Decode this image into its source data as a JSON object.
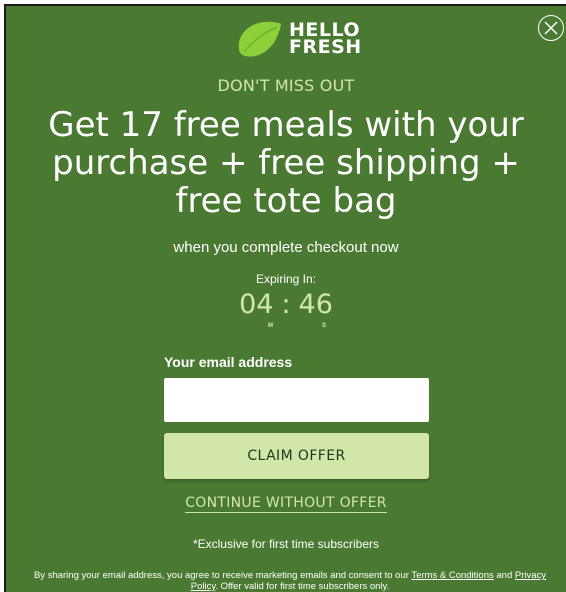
{
  "logo": {
    "line1": "HELLO",
    "line2": "FRESH"
  },
  "offer": {
    "eyebrow": "DON'T MISS OUT",
    "headline": "Get 17 free meals with your purchase + free shipping + free tote bag",
    "subline": "when you complete checkout now"
  },
  "timer": {
    "label": "Expiring In:",
    "minutes": "04",
    "separator": ":",
    "seconds": "46",
    "minutes_unit": "M",
    "seconds_unit": "S"
  },
  "form": {
    "email_label": "Your email address",
    "email_value": "",
    "email_placeholder": "",
    "claim_label": "CLAIM OFFER",
    "continue_label": "CONTINUE WITHOUT OFFER"
  },
  "footer": {
    "exclusive": "*Exclusive for first time subscribers",
    "legal_pre": "By sharing your email address, you agree to receive marketing emails and consent to our ",
    "terms_link": "Terms & Conditions",
    "legal_and": " and ",
    "privacy_link": "Privacy Policy",
    "legal_post": ". Offer valid for first time subscribers only."
  },
  "colors": {
    "background": "#4a7a32",
    "accent": "#d3e6a9",
    "lime": "#8dd13a",
    "text": "#ffffff"
  },
  "icons": {
    "close": "close-icon",
    "logo": "lime-icon"
  }
}
